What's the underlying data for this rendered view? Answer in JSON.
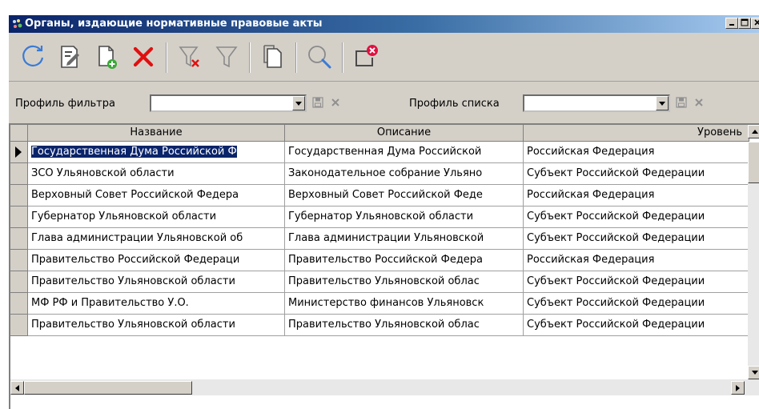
{
  "window": {
    "title": "Органы, издающие нормативные правовые акты"
  },
  "toolbar": {
    "buttons": [
      {
        "icon": "refresh-icon"
      },
      {
        "icon": "edit-icon"
      },
      {
        "icon": "new-document-icon"
      },
      {
        "icon": "delete-icon"
      },
      {
        "icon": "clear-filter-icon"
      },
      {
        "icon": "filter-icon"
      },
      {
        "icon": "copy-icon"
      },
      {
        "icon": "search-icon"
      },
      {
        "icon": "close-window-icon"
      }
    ],
    "colors": {
      "accent": "#3a7bd5",
      "delete": "#e01010",
      "add": "#3aa838",
      "close": "#e01040"
    }
  },
  "filterbar": {
    "filter_profile_label": "Профиль фильтра",
    "filter_profile_value": "",
    "list_profile_label": "Профиль списка",
    "list_profile_value": ""
  },
  "grid": {
    "columns": [
      "Название",
      "Описание",
      "Уровень"
    ],
    "rows": [
      [
        "Государственная Дума Российской Ф",
        "Государственная Дума Российской",
        "Российская Федерация"
      ],
      [
        "ЗСО Ульяновской области",
        "Законодательное собрание Ульяно",
        "Субъект  Российской Федерации"
      ],
      [
        "Верховный Совет Российской Федера",
        "Верховный Совет Российской Феде",
        "Российская Федерация"
      ],
      [
        "Губернатор Ульяновской области",
        "Губернатор Ульяновской области",
        "Субъект  Российской Федерации"
      ],
      [
        "Глава администрации Ульяновской об",
        "Глава администрации Ульяновской",
        "Субъект  Российской Федерации"
      ],
      [
        "Правительство Российской Федераци",
        "Правительство Российской Федера",
        "Российская Федерация"
      ],
      [
        "Правительство Ульяновской области",
        "Правительство Ульяновской облас",
        "Субъект  Российской Федерации"
      ],
      [
        "МФ РФ и Правительство У.О.",
        "Министерство финансов Ульяновск",
        "Субъект  Российской Федерации"
      ],
      [
        "Правительство Ульяновской области",
        "Правительство Ульяновской облас",
        "Субъект  Российской Федерации"
      ]
    ],
    "selected_row": 0
  }
}
